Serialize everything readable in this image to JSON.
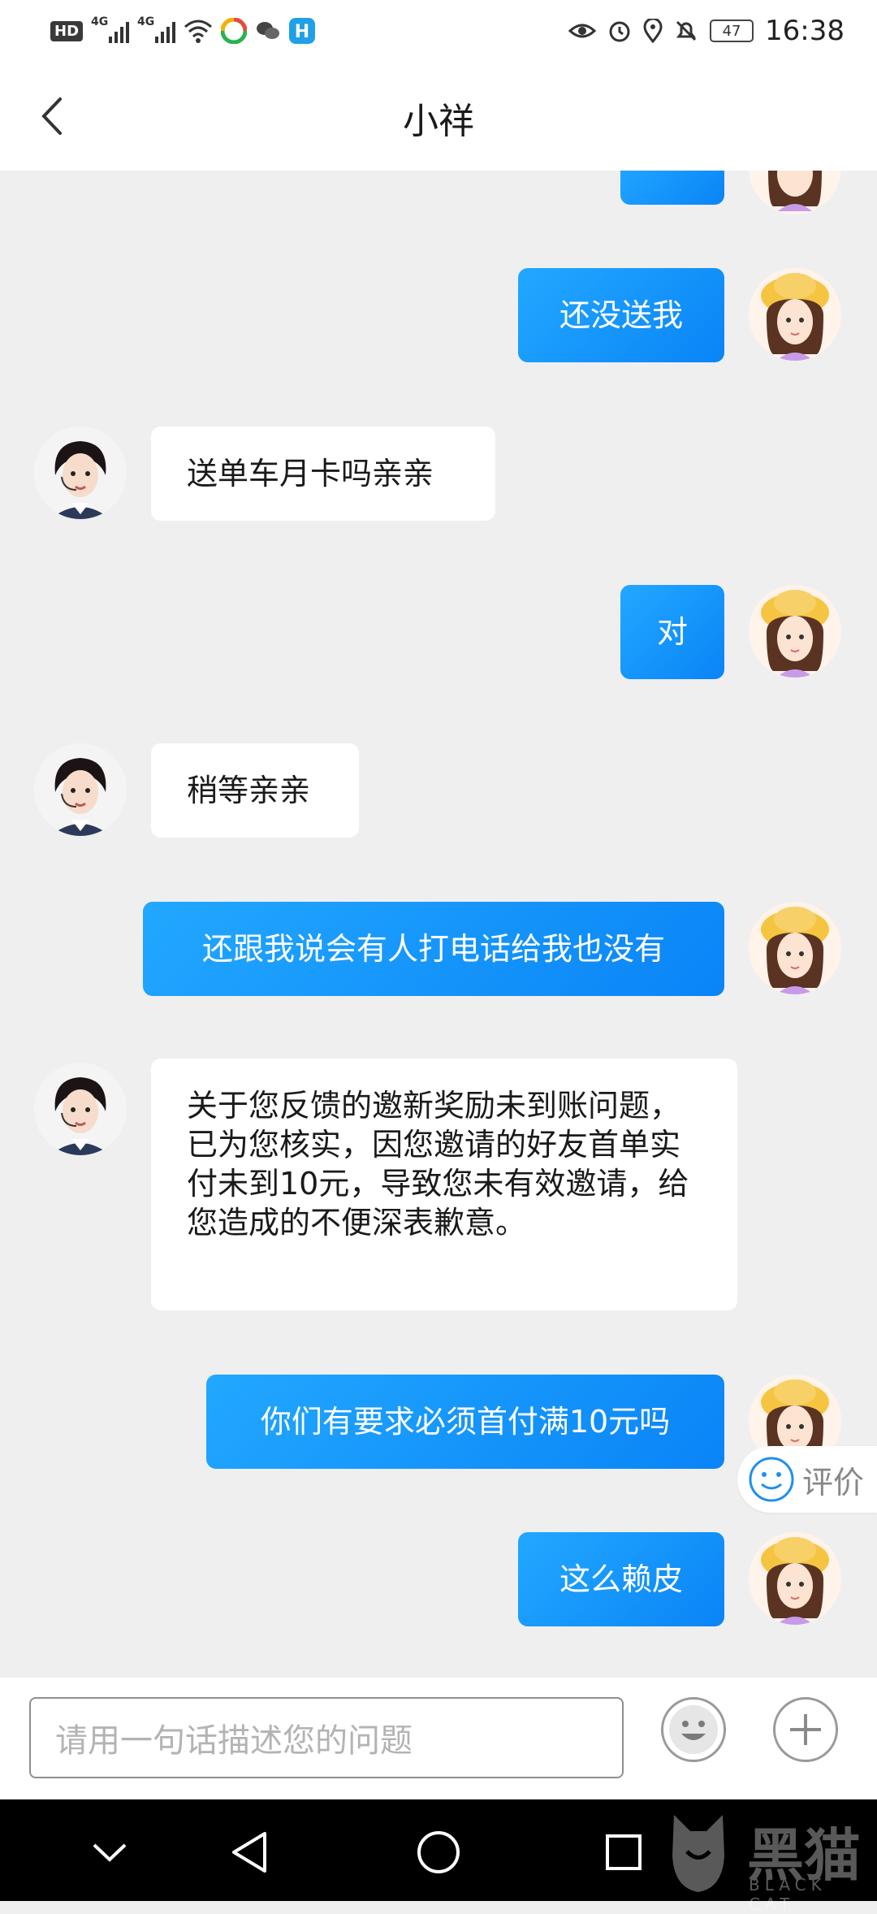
{
  "status_bar": {
    "hd": "HD",
    "network1": "4G",
    "network2": "4G",
    "battery": "47",
    "time": "16:38"
  },
  "header": {
    "title": "小祥"
  },
  "messages": {
    "m1": "还没送我",
    "m2": "送单车月卡吗亲亲",
    "m3": "对",
    "m4": "稍等亲亲",
    "m5": "还跟我说会有人打电话给我也没有",
    "m6": "关于您反馈的邀新奖励未到账问题，已为您核实，因您邀请的好友首单实付未到10元，导致您未有效邀请，给您造成的不便深表歉意。",
    "m7": "你们有要求必须首付满10元吗",
    "m8": "这么赖皮"
  },
  "rate": {
    "label": "评价"
  },
  "input": {
    "placeholder": "请用一句话描述您的问题"
  },
  "watermark": {
    "text": "黑猫",
    "sub": "BLACK CAT"
  },
  "colors": {
    "outgoing_bubble": "#0a84f7",
    "background": "#efeff0"
  }
}
